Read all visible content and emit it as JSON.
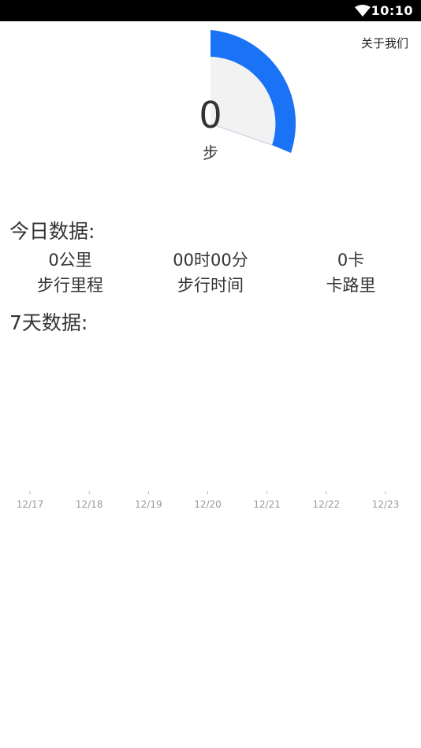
{
  "status_bar": {
    "time": "10:10",
    "wifi_icon": "wifi-icon"
  },
  "header": {
    "about_label": "关于我们"
  },
  "gauge": {
    "steps": "0",
    "unit": "步",
    "fill_fraction": 0.2,
    "accent_color": "#1a73f5",
    "track_color": "#f2f2f2"
  },
  "today": {
    "title": "今日数据:",
    "stats": [
      {
        "value": "0公里",
        "label": "步行里程"
      },
      {
        "value": "00时00分",
        "label": "步行时间"
      },
      {
        "value": "0卡",
        "label": "卡路里"
      }
    ]
  },
  "week": {
    "title": "7天数据:"
  },
  "chart_data": {
    "type": "bar",
    "categories": [
      "12/17",
      "12/18",
      "12/19",
      "12/20",
      "12/21",
      "12/22",
      "12/23"
    ],
    "values": [],
    "title": "",
    "xlabel": "",
    "ylabel": "",
    "tick_color": "#999999"
  }
}
